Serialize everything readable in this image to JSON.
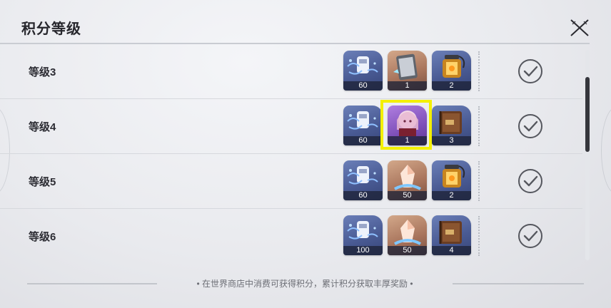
{
  "header": {
    "title": "积分等级"
  },
  "levels": [
    {
      "label": "等级3",
      "rewards": [
        {
          "icon": "crystal-icon",
          "qty": "60",
          "rarity": "blue"
        },
        {
          "icon": "phone-icon",
          "qty": "1",
          "rarity": "orange"
        },
        {
          "icon": "lantern-icon",
          "qty": "2",
          "rarity": "blue"
        }
      ],
      "claimed": true
    },
    {
      "label": "等级4",
      "rewards": [
        {
          "icon": "crystal-icon",
          "qty": "60",
          "rarity": "blue"
        },
        {
          "icon": "character-portrait-icon",
          "qty": "1",
          "rarity": "purple"
        },
        {
          "icon": "book-icon",
          "qty": "3",
          "rarity": "blue"
        }
      ],
      "claimed": true
    },
    {
      "label": "等级5",
      "rewards": [
        {
          "icon": "crystal-icon",
          "qty": "60",
          "rarity": "blue"
        },
        {
          "icon": "gem-shard-icon",
          "qty": "50",
          "rarity": "orange"
        },
        {
          "icon": "lantern-icon",
          "qty": "2",
          "rarity": "blue"
        }
      ],
      "claimed": true
    },
    {
      "label": "等级6",
      "rewards": [
        {
          "icon": "crystal-icon",
          "qty": "100",
          "rarity": "blue"
        },
        {
          "icon": "gem-shard-icon",
          "qty": "50",
          "rarity": "orange"
        },
        {
          "icon": "book-icon",
          "qty": "4",
          "rarity": "blue"
        }
      ],
      "claimed": true
    }
  ],
  "footer": {
    "text": "• 在世界商店中消费可获得积分，累计积分获取丰厚奖励 •"
  },
  "colors": {
    "highlight": "#f4f000",
    "rarity_blue": "#4a5b94",
    "rarity_orange": "#a7735b",
    "rarity_purple": "#7d4fb8"
  }
}
